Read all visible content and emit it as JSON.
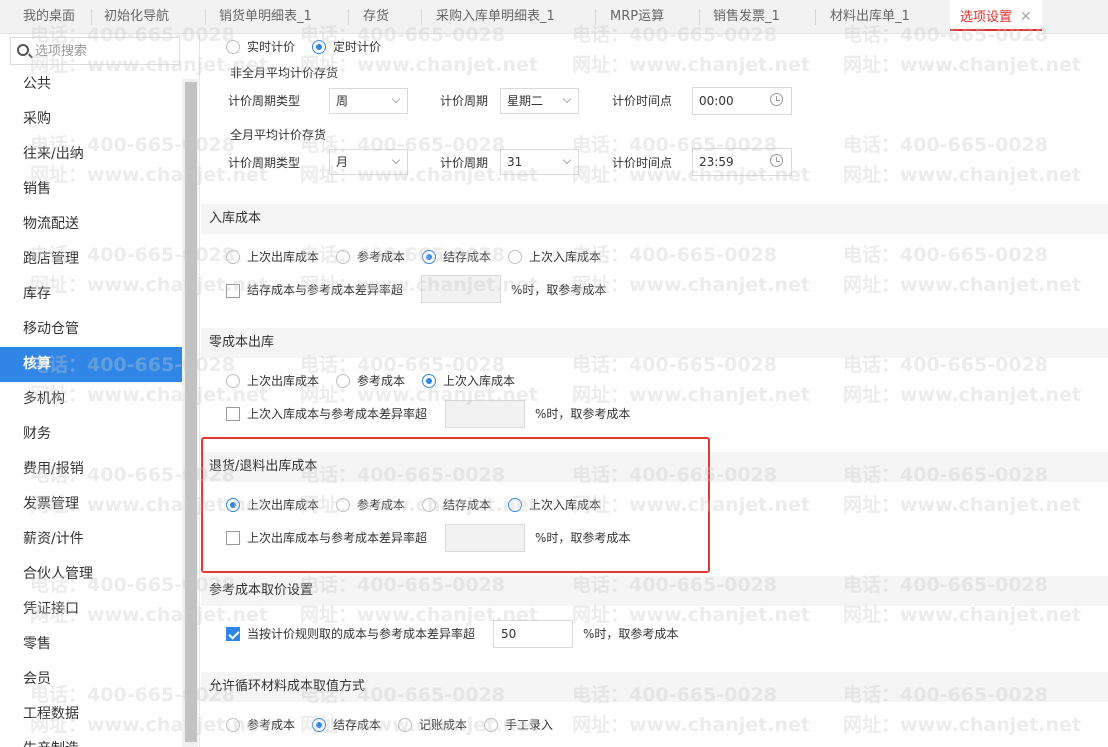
{
  "tabs": [
    {
      "label": "我的桌面"
    },
    {
      "label": "初始化导航"
    },
    {
      "label": "销货单明细表_1"
    },
    {
      "label": "存货"
    },
    {
      "label": "采购入库单明细表_1"
    },
    {
      "label": "MRP运算"
    },
    {
      "label": "销售发票_1"
    },
    {
      "label": "材料出库单_1"
    },
    {
      "label": "选项设置",
      "active": true
    }
  ],
  "tab_close_glyph": "✕",
  "sidebar": {
    "search_placeholder": "选项搜索",
    "items": [
      "公共",
      "采购",
      "往来/出纳",
      "销售",
      "物流配送",
      "跑店管理",
      "库存",
      "移动仓管",
      "核算",
      "多机构",
      "财务",
      "费用/报销",
      "发票管理",
      "薪资/计件",
      "合伙人管理",
      "凭证接口",
      "零售",
      "会员",
      "工程数据",
      "生产制造"
    ],
    "active_index": 8
  },
  "pricing": {
    "mode_realtime": "实时计价",
    "mode_scheduled": "定时计价",
    "mode_selected": "scheduled",
    "non_month": {
      "title": "非全月平均计价存货",
      "cycle_type_label": "计价周期类型",
      "cycle_type_value": "周",
      "cycle_label": "计价周期",
      "cycle_value": "星期二",
      "time_label": "计价时间点",
      "time_value": "00:00"
    },
    "month": {
      "title": "全月平均计价存货",
      "cycle_type_label": "计价周期类型",
      "cycle_type_value": "月",
      "cycle_label": "计价周期",
      "cycle_value": "31",
      "time_label": "计价时间点",
      "time_value": "23:59"
    }
  },
  "inbound_cost": {
    "title": "入库成本",
    "options": [
      "上次出库成本",
      "参考成本",
      "结存成本",
      "上次入库成本"
    ],
    "selected": 2,
    "check_label": "结存成本与参考成本差异率超",
    "checked": false,
    "suffix": "%时，取参考成本"
  },
  "zero_cost": {
    "title": "零成本出库",
    "options": [
      "上次出库成本",
      "参考成本",
      "上次入库成本"
    ],
    "selected": 2,
    "check_label": "上次入库成本与参考成本差异率超",
    "checked": false,
    "suffix": "%时，取参考成本"
  },
  "return_cost": {
    "title": "退货/退料出库成本",
    "options": [
      "上次出库成本",
      "参考成本",
      "结存成本",
      "上次入库成本"
    ],
    "selected": 0,
    "check_label": "上次出库成本与参考成本差异率超",
    "checked": false,
    "suffix": "%时，取参考成本"
  },
  "ref_cost": {
    "title": "参考成本取价设置",
    "check_label": "当按计价规则取的成本与参考成本差异率超",
    "checked": true,
    "value": "50",
    "suffix": "%时，取参考成本"
  },
  "cycle_material": {
    "title": "允许循环材料成本取值方式",
    "options": [
      "参考成本",
      "结存成本",
      "记账成本",
      "手工录入"
    ],
    "selected": 1
  },
  "watermark": {
    "phone": "电话：400-665-0028",
    "site": "网址：www.chanjet.net"
  },
  "colors": {
    "accent": "#2f86e6",
    "tab_active": "#e0302b",
    "highlight": "#e53935"
  }
}
